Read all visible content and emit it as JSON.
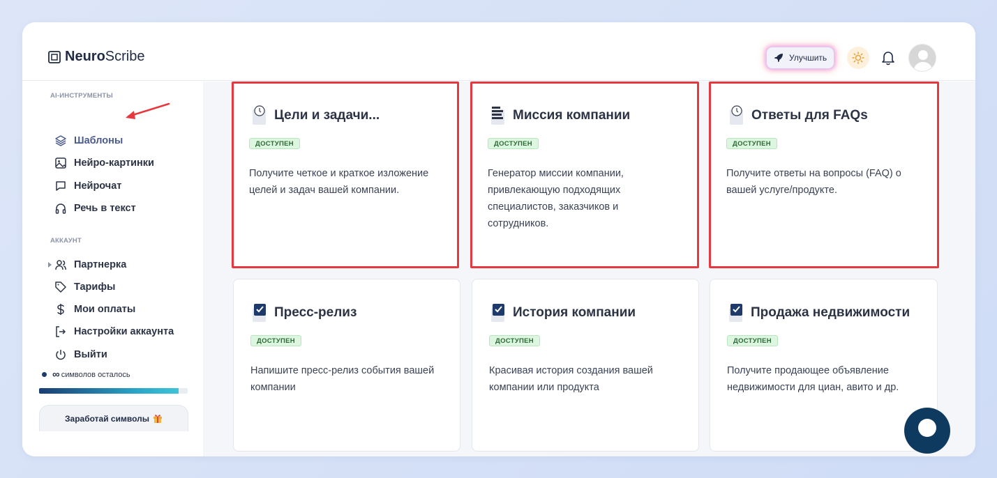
{
  "app": {
    "name_bold": "Neuro",
    "name_regular": "Scribe"
  },
  "header": {
    "upgrade_label": "Улучшить"
  },
  "sidebar": {
    "section_ai": "AI-ИНСТРУМЕНТЫ",
    "ai_items": [
      {
        "label": "Шаблоны",
        "icon": "layers-icon"
      },
      {
        "label": "Нейро-картинки",
        "icon": "image-icon"
      },
      {
        "label": "Нейрочат",
        "icon": "chat-icon"
      },
      {
        "label": "Речь в текст",
        "icon": "headphones-icon"
      }
    ],
    "section_account": "АККАУНТ",
    "account_items": [
      {
        "label": "Партнерка",
        "icon": "users-icon"
      },
      {
        "label": "Тарифы",
        "icon": "tag-icon"
      },
      {
        "label": "Мои оплаты",
        "icon": "dollar-icon"
      },
      {
        "label": "Настройки аккаунта",
        "icon": "login-icon"
      },
      {
        "label": "Выйти",
        "icon": "power-icon"
      }
    ],
    "symbols_infinity": "∞",
    "symbols_text": "символов осталось",
    "symbols_fraction": 0.94,
    "earn_label": "Заработай символы"
  },
  "cards": [
    {
      "title": "Цели и задачи...",
      "badge": "ДОСТУПЕН",
      "description": "Получите четкое и краткое изложение целей и задач вашей компании.",
      "icon": "clock-doc-icon",
      "highlighted": true
    },
    {
      "title": "Миссия компании",
      "badge": "ДОСТУПЕН",
      "description": "Генератор миссии компании, привлекающую подходящих специалистов, заказчиков и сотрудников.",
      "icon": "list-doc-icon",
      "highlighted": true
    },
    {
      "title": "Ответы для FAQs",
      "badge": "ДОСТУПЕН",
      "description": "Получите ответы на вопросы (FAQ) о вашей услуге/продукте.",
      "icon": "clock-doc-icon",
      "highlighted": true
    },
    {
      "title": "Пресс-релиз",
      "badge": "ДОСТУПЕН",
      "description": "Напишите пресс-релиз события вашей компании",
      "icon": "check-doc-icon",
      "highlighted": false
    },
    {
      "title": "История компании",
      "badge": "ДОСТУПЕН",
      "description": "Красивая история создания вашей компании или продукта",
      "icon": "check-doc-icon",
      "highlighted": false
    },
    {
      "title": "Продажа недвижимости",
      "badge": "ДОСТУПЕН",
      "description": "Получите продающее объявление недвижимости для циан, авито и др.",
      "icon": "check-doc-icon",
      "highlighted": false
    }
  ],
  "colors": {
    "highlight": "#e5393f",
    "accent_dark": "#1d3a6b",
    "badge_bg": "#dcf6df"
  }
}
